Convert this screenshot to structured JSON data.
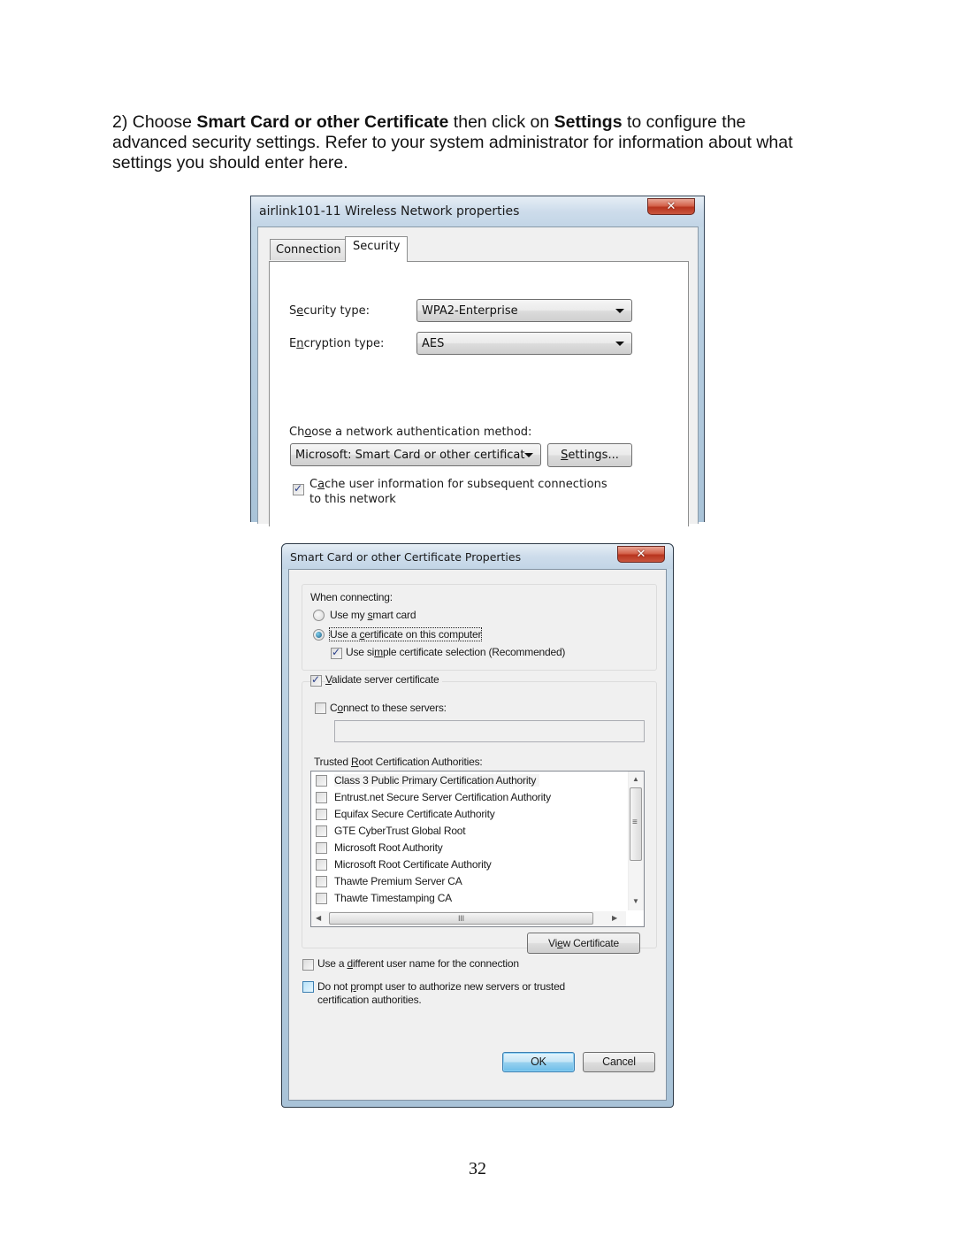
{
  "instruction": {
    "step": "2) Choose ",
    "bold1": "Smart Card or other Certificate",
    "mid1": " then click on ",
    "bold2": "Settings",
    "rest": " to configure the advanced security settings. Refer to your system administrator for information about what settings you should enter here."
  },
  "dialog1": {
    "title": "airlink101-11 Wireless Network properties",
    "close_glyph": "✕",
    "tabs": [
      {
        "label": "Connection",
        "active": false
      },
      {
        "label": "Security",
        "active": true
      }
    ],
    "security_type": {
      "label_pre": "S",
      "label_u": "e",
      "label_post": "curity type:",
      "value": "WPA2-Enterprise"
    },
    "encryption_type": {
      "label_pre": "E",
      "label_u": "n",
      "label_post": "cryption type:",
      "value": "AES"
    },
    "auth_method": {
      "label_pre": "Ch",
      "label_u": "o",
      "label_post": "ose a network authentication method:",
      "value": "Microsoft: Smart Card or other certificat"
    },
    "settings_button": {
      "u": "S",
      "rest": "ettings..."
    },
    "cache_checkbox": {
      "checked": true,
      "line1_pre": "C",
      "line1_u": "a",
      "line1_post": "che user information for subsequent connections",
      "line2": "to this network"
    }
  },
  "dialog2": {
    "title": "Smart Card or other Certificate Properties",
    "close_glyph": "✕",
    "when_connecting": "When connecting:",
    "radio_smart_card": {
      "pre": "Use my ",
      "u": "s",
      "post": "mart card",
      "selected": false
    },
    "radio_certificate": {
      "pre": "Use a ",
      "u": "c",
      "post": "ertificate on this computer",
      "selected": true
    },
    "simple_selection": {
      "pre": "Use si",
      "u": "m",
      "post": "ple certificate selection (Recommended)",
      "checked": true
    },
    "validate_server": {
      "u": "V",
      "post": "alidate server certificate",
      "checked": true
    },
    "connect_servers": {
      "pre": "C",
      "u": "o",
      "post": "nnect to these servers:",
      "checked": false,
      "value": ""
    },
    "trusted_root_label": {
      "pre": "Trusted ",
      "u": "R",
      "post": "oot Certification Authorities:"
    },
    "trusted_roots": [
      {
        "name": "Class 3 Public Primary Certification Authority",
        "checked": false
      },
      {
        "name": "Entrust.net Secure Server Certification Authority",
        "checked": false
      },
      {
        "name": "Equifax Secure Certificate Authority",
        "checked": false
      },
      {
        "name": "GTE CyberTrust Global Root",
        "checked": false
      },
      {
        "name": "Microsoft Root Authority",
        "checked": false
      },
      {
        "name": "Microsoft Root Certificate Authority",
        "checked": false
      },
      {
        "name": "Thawte Premium Server CA",
        "checked": false
      },
      {
        "name": "Thawte Timestamping CA",
        "checked": false
      }
    ],
    "scroll_glyphs": {
      "up": "▲",
      "down": "▼",
      "left": "◀",
      "right": "▶",
      "grip_v": "≡",
      "grip_h": "III"
    },
    "view_certificate": {
      "pre": "Vi",
      "u": "e",
      "post": "w Certificate"
    },
    "different_user": {
      "pre": "Use a ",
      "u": "d",
      "post": "ifferent user name for the connection",
      "checked": false
    },
    "no_prompt": {
      "pre": "Do not ",
      "u": "p",
      "post": "rompt user to authorize new servers or trusted",
      "line2": "certification authorities.",
      "checked": false
    },
    "ok_label": "OK",
    "cancel_label": "Cancel"
  },
  "page_number": "32"
}
